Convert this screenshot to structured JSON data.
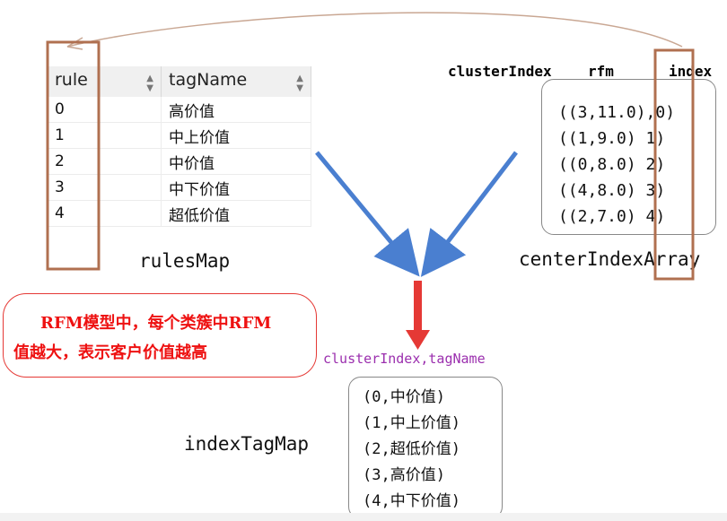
{
  "rules_table": {
    "headers": [
      "rule",
      "tagName"
    ],
    "sort_icon": "sort-icon",
    "rows": [
      {
        "rule": "0",
        "tagName": "高价值"
      },
      {
        "rule": "1",
        "tagName": "中上价值"
      },
      {
        "rule": "2",
        "tagName": "中价值"
      },
      {
        "rule": "3",
        "tagName": "中下价值"
      },
      {
        "rule": "4",
        "tagName": "超低价值"
      }
    ]
  },
  "rules_map_label": "rulesMap",
  "center_headers": {
    "cluster_index": "clusterIndex",
    "rfm": "rfm",
    "index": "index"
  },
  "center_index_rows": [
    "((3,11.0),0)",
    "((1,9.0) 1)",
    "((0,8.0) 2)",
    "((4,8.0) 3)",
    "((2,7.0) 4)"
  ],
  "center_index_label": "centerIndexArray",
  "note": {
    "line1": "RFM模型中，每个类簇中RFM",
    "line2": "值越大，表示客户价值越高"
  },
  "result_header": "clusterIndex,tagName",
  "index_tag_rows": [
    "(0,中价值)",
    "(1,中上价值)",
    "(2,超低价值)",
    "(3,高价值)",
    "(4,中下价值)"
  ],
  "index_tag_label": "indexTagMap",
  "colors": {
    "highlight_border": "#b07050",
    "merge_arrows": "#4a7fd0",
    "result_arrow": "#e53935",
    "note_text": "#ee1111",
    "header_purple": "#9b2fae"
  }
}
